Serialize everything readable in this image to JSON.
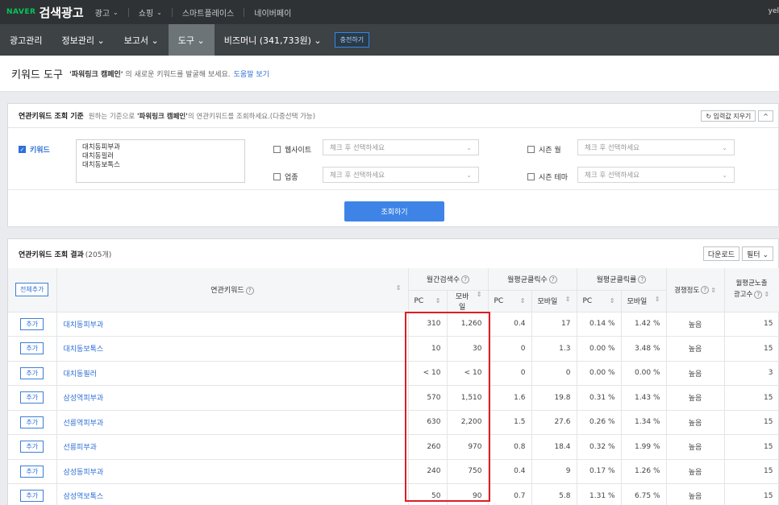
{
  "topbar": {
    "brand_logo": "NAVER",
    "brand_name": "검색광고",
    "menus": [
      {
        "label": "광고",
        "has_dropdown": true
      },
      {
        "label": "쇼핑",
        "has_dropdown": true
      },
      {
        "label": "스마트플레이스",
        "has_dropdown": false
      },
      {
        "label": "네이버페이",
        "has_dropdown": false
      }
    ],
    "user": "yel"
  },
  "navbar": {
    "items": [
      {
        "label": "광고관리",
        "active": false
      },
      {
        "label": "정보관리 ⌄",
        "active": false
      },
      {
        "label": "보고서 ⌄",
        "active": false
      },
      {
        "label": "도구 ⌄",
        "active": true
      },
      {
        "label": "비즈머니 (341,733원) ⌄",
        "active": false
      }
    ],
    "charge_label": "충전하기"
  },
  "page_header": {
    "title": "키워드 도구",
    "desc_bold": "'파워링크 캠페인'",
    "desc_rest": " 의 새로운 키워드를 발굴해 보세요.",
    "help_link": "도움말 보기"
  },
  "criteria": {
    "title": "연관키워드 조회 기준",
    "desc_pre": "원하는 기준으로 ",
    "desc_bold": "'파워링크 캠페인'",
    "desc_post": "의 연관키워드를 조회하세요.(다중선택 가능)",
    "reset_label": "입력값 지우기",
    "collapse_label": "^",
    "keyword_label": "키워드",
    "keyword_lines": [
      "대치동피부과",
      "대치동필러",
      "대치동보톡스"
    ],
    "website_label": "웹사이트",
    "industry_label": "업종",
    "season_month_label": "시즌 월",
    "season_theme_label": "시즌 테마",
    "select_placeholder": "체크 후 선택하세요",
    "search_button": "조회하기"
  },
  "results": {
    "title": "연관키워드 조회 결과",
    "count": "(205개)",
    "download_label": "다운로드",
    "filter_label": "필터 ⌄",
    "add_all_label": "전체추가",
    "headers": {
      "keyword": "연관키워드",
      "monthly_search": "월간검색수",
      "avg_clicks": "월평균클릭수",
      "avg_ctr": "월평균클릭률",
      "competition": "경쟁정도",
      "avg_ads_line1": "월평균노출",
      "avg_ads_line2": "광고수",
      "pc": "PC",
      "mobile": "모바일",
      "help": "?",
      "sort": "⇕"
    },
    "add_label": "추가",
    "rows": [
      {
        "keyword": "대치동피부과",
        "search_pc": "310",
        "search_mobile": "1,260",
        "click_pc": "0.4",
        "click_mobile": "17",
        "ctr_pc": "0.14 %",
        "ctr_mobile": "1.42 %",
        "competition": "높음",
        "ads": "15"
      },
      {
        "keyword": "대치동보톡스",
        "search_pc": "10",
        "search_mobile": "30",
        "click_pc": "0",
        "click_mobile": "1.3",
        "ctr_pc": "0.00 %",
        "ctr_mobile": "3.48 %",
        "competition": "높음",
        "ads": "15"
      },
      {
        "keyword": "대치동필러",
        "search_pc": "< 10",
        "search_mobile": "< 10",
        "click_pc": "0",
        "click_mobile": "0",
        "ctr_pc": "0.00 %",
        "ctr_mobile": "0.00 %",
        "competition": "높음",
        "ads": "3"
      },
      {
        "keyword": "삼성역피부과",
        "search_pc": "570",
        "search_mobile": "1,510",
        "click_pc": "1.6",
        "click_mobile": "19.8",
        "ctr_pc": "0.31 %",
        "ctr_mobile": "1.43 %",
        "competition": "높음",
        "ads": "15"
      },
      {
        "keyword": "선릉역피부과",
        "search_pc": "630",
        "search_mobile": "2,200",
        "click_pc": "1.5",
        "click_mobile": "27.6",
        "ctr_pc": "0.26 %",
        "ctr_mobile": "1.34 %",
        "competition": "높음",
        "ads": "15"
      },
      {
        "keyword": "선릉피부과",
        "search_pc": "260",
        "search_mobile": "970",
        "click_pc": "0.8",
        "click_mobile": "18.4",
        "ctr_pc": "0.32 %",
        "ctr_mobile": "1.99 %",
        "competition": "높음",
        "ads": "15"
      },
      {
        "keyword": "삼성동피부과",
        "search_pc": "240",
        "search_mobile": "750",
        "click_pc": "0.4",
        "click_mobile": "9",
        "ctr_pc": "0.17 %",
        "ctr_mobile": "1.26 %",
        "competition": "높음",
        "ads": "15"
      },
      {
        "keyword": "삼성역보톡스",
        "search_pc": "50",
        "search_mobile": "90",
        "click_pc": "0.7",
        "click_mobile": "5.8",
        "ctr_pc": "1.31 %",
        "ctr_mobile": "6.75 %",
        "competition": "높음",
        "ads": "15"
      }
    ]
  },
  "colors": {
    "topbar_bg": "#2f3234",
    "navbar_bg": "#3d4244",
    "nav_active_bg": "#6c7478",
    "accent_blue": "#3e84e6",
    "highlight_red": "#e11c24",
    "naver_green": "#03c75a"
  }
}
